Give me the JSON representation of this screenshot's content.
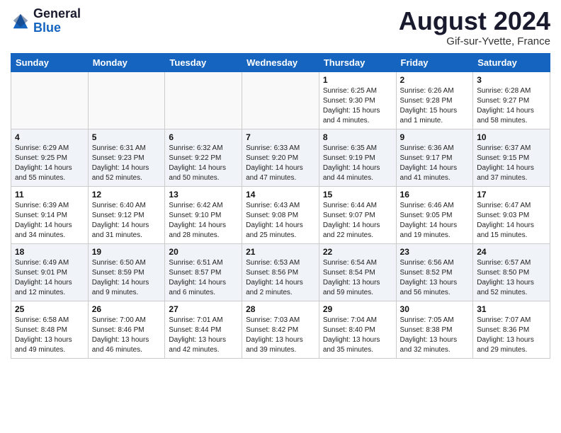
{
  "header": {
    "logo_general": "General",
    "logo_blue": "Blue",
    "month_year": "August 2024",
    "location": "Gif-sur-Yvette, France"
  },
  "days_of_week": [
    "Sunday",
    "Monday",
    "Tuesday",
    "Wednesday",
    "Thursday",
    "Friday",
    "Saturday"
  ],
  "weeks": [
    [
      {
        "day": "",
        "info": ""
      },
      {
        "day": "",
        "info": ""
      },
      {
        "day": "",
        "info": ""
      },
      {
        "day": "",
        "info": ""
      },
      {
        "day": "1",
        "info": "Sunrise: 6:25 AM\nSunset: 9:30 PM\nDaylight: 15 hours\nand 4 minutes."
      },
      {
        "day": "2",
        "info": "Sunrise: 6:26 AM\nSunset: 9:28 PM\nDaylight: 15 hours\nand 1 minute."
      },
      {
        "day": "3",
        "info": "Sunrise: 6:28 AM\nSunset: 9:27 PM\nDaylight: 14 hours\nand 58 minutes."
      }
    ],
    [
      {
        "day": "4",
        "info": "Sunrise: 6:29 AM\nSunset: 9:25 PM\nDaylight: 14 hours\nand 55 minutes."
      },
      {
        "day": "5",
        "info": "Sunrise: 6:31 AM\nSunset: 9:23 PM\nDaylight: 14 hours\nand 52 minutes."
      },
      {
        "day": "6",
        "info": "Sunrise: 6:32 AM\nSunset: 9:22 PM\nDaylight: 14 hours\nand 50 minutes."
      },
      {
        "day": "7",
        "info": "Sunrise: 6:33 AM\nSunset: 9:20 PM\nDaylight: 14 hours\nand 47 minutes."
      },
      {
        "day": "8",
        "info": "Sunrise: 6:35 AM\nSunset: 9:19 PM\nDaylight: 14 hours\nand 44 minutes."
      },
      {
        "day": "9",
        "info": "Sunrise: 6:36 AM\nSunset: 9:17 PM\nDaylight: 14 hours\nand 41 minutes."
      },
      {
        "day": "10",
        "info": "Sunrise: 6:37 AM\nSunset: 9:15 PM\nDaylight: 14 hours\nand 37 minutes."
      }
    ],
    [
      {
        "day": "11",
        "info": "Sunrise: 6:39 AM\nSunset: 9:14 PM\nDaylight: 14 hours\nand 34 minutes."
      },
      {
        "day": "12",
        "info": "Sunrise: 6:40 AM\nSunset: 9:12 PM\nDaylight: 14 hours\nand 31 minutes."
      },
      {
        "day": "13",
        "info": "Sunrise: 6:42 AM\nSunset: 9:10 PM\nDaylight: 14 hours\nand 28 minutes."
      },
      {
        "day": "14",
        "info": "Sunrise: 6:43 AM\nSunset: 9:08 PM\nDaylight: 14 hours\nand 25 minutes."
      },
      {
        "day": "15",
        "info": "Sunrise: 6:44 AM\nSunset: 9:07 PM\nDaylight: 14 hours\nand 22 minutes."
      },
      {
        "day": "16",
        "info": "Sunrise: 6:46 AM\nSunset: 9:05 PM\nDaylight: 14 hours\nand 19 minutes."
      },
      {
        "day": "17",
        "info": "Sunrise: 6:47 AM\nSunset: 9:03 PM\nDaylight: 14 hours\nand 15 minutes."
      }
    ],
    [
      {
        "day": "18",
        "info": "Sunrise: 6:49 AM\nSunset: 9:01 PM\nDaylight: 14 hours\nand 12 minutes."
      },
      {
        "day": "19",
        "info": "Sunrise: 6:50 AM\nSunset: 8:59 PM\nDaylight: 14 hours\nand 9 minutes."
      },
      {
        "day": "20",
        "info": "Sunrise: 6:51 AM\nSunset: 8:57 PM\nDaylight: 14 hours\nand 6 minutes."
      },
      {
        "day": "21",
        "info": "Sunrise: 6:53 AM\nSunset: 8:56 PM\nDaylight: 14 hours\nand 2 minutes."
      },
      {
        "day": "22",
        "info": "Sunrise: 6:54 AM\nSunset: 8:54 PM\nDaylight: 13 hours\nand 59 minutes."
      },
      {
        "day": "23",
        "info": "Sunrise: 6:56 AM\nSunset: 8:52 PM\nDaylight: 13 hours\nand 56 minutes."
      },
      {
        "day": "24",
        "info": "Sunrise: 6:57 AM\nSunset: 8:50 PM\nDaylight: 13 hours\nand 52 minutes."
      }
    ],
    [
      {
        "day": "25",
        "info": "Sunrise: 6:58 AM\nSunset: 8:48 PM\nDaylight: 13 hours\nand 49 minutes."
      },
      {
        "day": "26",
        "info": "Sunrise: 7:00 AM\nSunset: 8:46 PM\nDaylight: 13 hours\nand 46 minutes."
      },
      {
        "day": "27",
        "info": "Sunrise: 7:01 AM\nSunset: 8:44 PM\nDaylight: 13 hours\nand 42 minutes."
      },
      {
        "day": "28",
        "info": "Sunrise: 7:03 AM\nSunset: 8:42 PM\nDaylight: 13 hours\nand 39 minutes."
      },
      {
        "day": "29",
        "info": "Sunrise: 7:04 AM\nSunset: 8:40 PM\nDaylight: 13 hours\nand 35 minutes."
      },
      {
        "day": "30",
        "info": "Sunrise: 7:05 AM\nSunset: 8:38 PM\nDaylight: 13 hours\nand 32 minutes."
      },
      {
        "day": "31",
        "info": "Sunrise: 7:07 AM\nSunset: 8:36 PM\nDaylight: 13 hours\nand 29 minutes."
      }
    ]
  ]
}
